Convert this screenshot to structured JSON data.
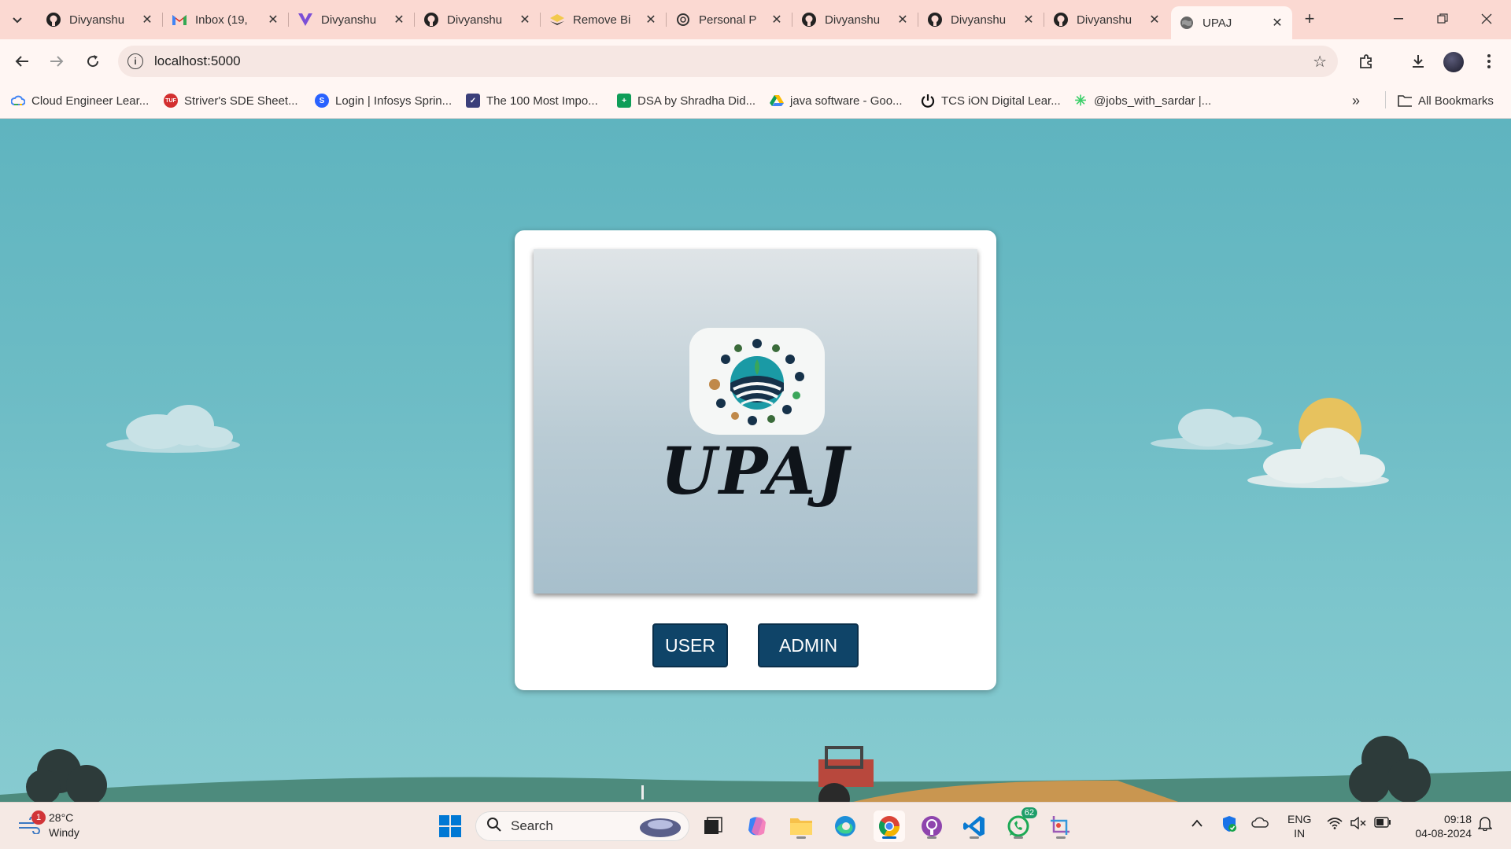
{
  "browser": {
    "tabs": [
      {
        "title": "Divyanshu",
        "icon": "github-icon"
      },
      {
        "title": "Inbox (19,",
        "icon": "gmail-icon"
      },
      {
        "title": "Divyanshu",
        "icon": "vercel-icon"
      },
      {
        "title": "Divyanshu",
        "icon": "github-icon"
      },
      {
        "title": "Remove Bi",
        "icon": "removebg-icon"
      },
      {
        "title": "Personal P",
        "icon": "openai-icon"
      },
      {
        "title": "Divyanshu",
        "icon": "github-icon"
      },
      {
        "title": "Divyanshu",
        "icon": "github-icon"
      },
      {
        "title": "Divyanshu",
        "icon": "github-icon"
      },
      {
        "title": "UPAJ",
        "icon": "globe-icon",
        "active": true
      }
    ],
    "url": "localhost:5000",
    "bookmarks": [
      {
        "label": "Cloud Engineer Lear...",
        "icon": "google-cloud-icon"
      },
      {
        "label": "Striver's SDE Sheet...",
        "icon": "takeuforward-icon"
      },
      {
        "label": "Login | Infosys Sprin...",
        "icon": "infosys-icon"
      },
      {
        "label": "The 100 Most Impo...",
        "icon": "shield-icon"
      },
      {
        "label": "DSA by Shradha Did...",
        "icon": "google-sheets-icon"
      },
      {
        "label": "java software - Goo...",
        "icon": "google-drive-icon"
      },
      {
        "label": "TCS iON Digital Lear...",
        "icon": "power-icon"
      },
      {
        "label": "@jobs_with_sardar |...",
        "icon": "asterisk-icon"
      }
    ],
    "all_bookmarks_label": "All Bookmarks"
  },
  "app": {
    "brand": "UPAJ",
    "user_button": "USER",
    "admin_button": "ADMIN"
  },
  "taskbar": {
    "weather_temp": "28°C",
    "weather_desc": "Windy",
    "weather_badge": "1",
    "search_label": "Search",
    "whatsapp_badge": "62",
    "lang_line1": "ENG",
    "lang_line2": "IN",
    "time": "09:18",
    "date": "04-08-2024"
  },
  "colors": {
    "tabbar_bg": "#fbd9d2",
    "button_bg": "#0f4468",
    "sky": "#6dbcc5"
  }
}
